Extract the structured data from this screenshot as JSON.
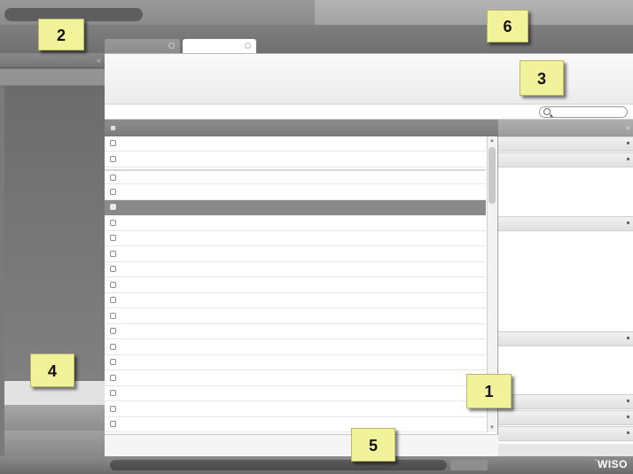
{
  "window": {
    "title": "",
    "tabs": [
      {
        "label": "",
        "state": "inactive"
      },
      {
        "label": "",
        "state": "active"
      }
    ]
  },
  "sidebar": {
    "collapse_icon": "double-chevron-left-icon",
    "items": []
  },
  "search": {
    "placeholder": "",
    "value": "",
    "icon": "magnifier-icon"
  },
  "list": {
    "columns": [],
    "row_count": 19,
    "selected_row_index": 4,
    "rows": []
  },
  "right_panel": {
    "expand_icon": "double-chevron-right-icon",
    "sections": []
  },
  "statusbar": {
    "brand": "WISO",
    "brand_prefix": "°"
  },
  "callouts": {
    "c1": "1",
    "c2": "2",
    "c3": "3",
    "c4": "4",
    "c5": "5",
    "c6": "6"
  },
  "colors": {
    "callout_fill": "#f2f29a",
    "selected_row": "#8a8a8a",
    "chrome_dark": "#7a7a7a"
  }
}
